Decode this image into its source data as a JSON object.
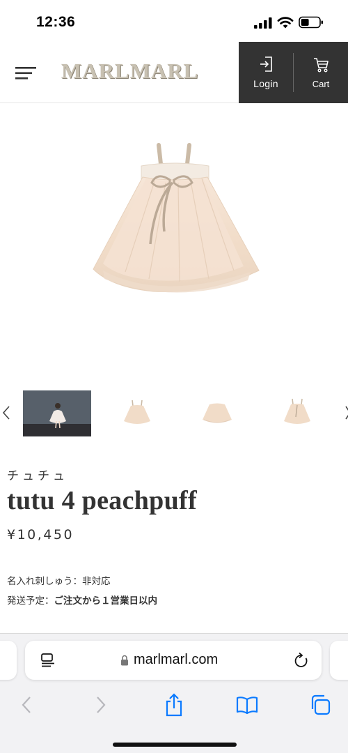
{
  "status_bar": {
    "time": "12:36"
  },
  "header": {
    "logo": "MARLMARL",
    "login_label": "Login",
    "cart_label": "Cart",
    "icons": [
      "menu-icon",
      "login-icon",
      "cart-icon"
    ],
    "colors": {
      "actions_bg": "#333333",
      "logo": "#c8c1b2"
    }
  },
  "product": {
    "kana_name": "チュチュ",
    "title": "tutu 4 peachpuff",
    "price": "¥10,450",
    "specs": [
      {
        "label": "名入れ刺しゅう：",
        "value": "非対応"
      },
      {
        "label": "発送予定：",
        "value": "ご注文から１営業日以内"
      }
    ],
    "thumbnail_count": 4,
    "colors": {
      "tutu": "#f4e2d2",
      "ribbon": "#cdbdaa"
    }
  },
  "browser": {
    "url": "marlmarl.com",
    "icons": [
      "page-menu-icon",
      "lock-icon",
      "reload-icon",
      "back-icon",
      "forward-icon",
      "share-icon",
      "bookmarks-icon",
      "tabs-icon"
    ],
    "accent": "#0a7aff"
  }
}
